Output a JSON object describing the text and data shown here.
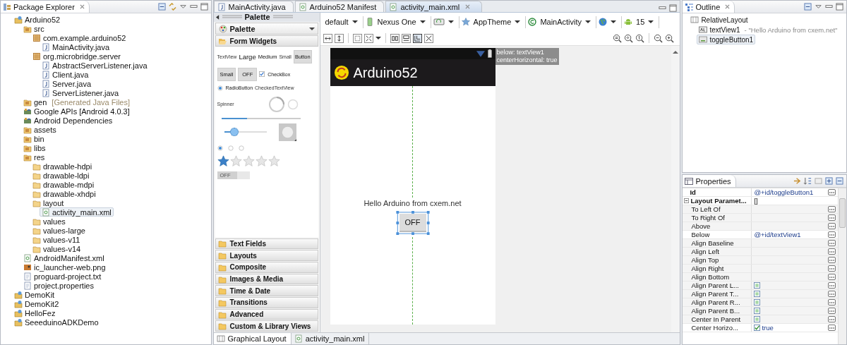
{
  "package_explorer": {
    "title": "Package Explorer",
    "tree": [
      {
        "label": "Arduino52",
        "kind": "project",
        "selected": false,
        "children": [
          {
            "label": "src",
            "kind": "source",
            "selected": false,
            "children": [
              {
                "label": "com.example.arduino52",
                "kind": "package",
                "selected": false,
                "children": [
                  {
                    "label": "MainActivity.java",
                    "kind": "java",
                    "selected": false
                  }
                ]
              },
              {
                "label": "org.microbridge.server",
                "kind": "package",
                "selected": false,
                "children": [
                  {
                    "label": "AbstractServerListener.java",
                    "kind": "java",
                    "selected": false
                  },
                  {
                    "label": "Client.java",
                    "kind": "java",
                    "selected": false
                  },
                  {
                    "label": "Server.java",
                    "kind": "java",
                    "selected": false
                  },
                  {
                    "label": "ServerListener.java",
                    "kind": "java",
                    "selected": false
                  }
                ]
              }
            ]
          },
          {
            "label": "gen",
            "note": "[Generated Java Files]",
            "kind": "source",
            "selected": false
          },
          {
            "label": "Google APIs [Android 4.0.3]",
            "kind": "library",
            "selected": false
          },
          {
            "label": "Android Dependencies",
            "kind": "library",
            "selected": false
          },
          {
            "label": "assets",
            "kind": "source",
            "selected": false
          },
          {
            "label": "bin",
            "kind": "source",
            "selected": false
          },
          {
            "label": "libs",
            "kind": "source",
            "selected": false
          },
          {
            "label": "res",
            "kind": "source",
            "selected": false,
            "children": [
              {
                "label": "drawable-hdpi",
                "kind": "folder",
                "selected": false
              },
              {
                "label": "drawable-ldpi",
                "kind": "folder",
                "selected": false
              },
              {
                "label": "drawable-mdpi",
                "kind": "folder",
                "selected": false
              },
              {
                "label": "drawable-xhdpi",
                "kind": "folder",
                "selected": false
              },
              {
                "label": "layout",
                "kind": "folder",
                "selected": false,
                "children": [
                  {
                    "label": "activity_main.xml",
                    "kind": "xml",
                    "selected": true
                  }
                ]
              },
              {
                "label": "values",
                "kind": "folder",
                "selected": false
              },
              {
                "label": "values-large",
                "kind": "folder",
                "selected": false
              },
              {
                "label": "values-v11",
                "kind": "folder",
                "selected": false
              },
              {
                "label": "values-v14",
                "kind": "folder",
                "selected": false
              }
            ]
          },
          {
            "label": "AndroidManifest.xml",
            "kind": "xml",
            "selected": false
          },
          {
            "label": "ic_launcher-web.png",
            "kind": "image",
            "selected": false
          },
          {
            "label": "proguard-project.txt",
            "kind": "text",
            "selected": false
          },
          {
            "label": "project.properties",
            "kind": "text",
            "selected": false
          }
        ]
      },
      {
        "label": "DemoKit",
        "kind": "project",
        "selected": false
      },
      {
        "label": "DemoKit2",
        "kind": "project",
        "selected": false
      },
      {
        "label": "HelloFez",
        "kind": "project",
        "selected": false
      },
      {
        "label": "SeeeduinoADKDemo",
        "kind": "project",
        "selected": false
      }
    ]
  },
  "editor_tabs": [
    {
      "label": "MainActivity.java",
      "kind": "java",
      "selected": false
    },
    {
      "label": "Arduino52 Manifest",
      "kind": "xml",
      "selected": false
    },
    {
      "label": "activity_main.xml",
      "kind": "xml",
      "selected": true
    }
  ],
  "palette": {
    "title": "Palette",
    "dropdown": "Palette",
    "sections": [
      {
        "label": "Form Widgets",
        "expanded": true
      },
      {
        "label": "Text Fields",
        "expanded": false
      },
      {
        "label": "Layouts",
        "expanded": false
      },
      {
        "label": "Composite",
        "expanded": false
      },
      {
        "label": "Images & Media",
        "expanded": false
      },
      {
        "label": "Time & Date",
        "expanded": false
      },
      {
        "label": "Transitions",
        "expanded": false
      },
      {
        "label": "Advanced",
        "expanded": false
      },
      {
        "label": "Custom & Library Views",
        "expanded": false
      }
    ],
    "widgets": {
      "text_views": [
        {
          "label": "TextView",
          "kind": "tiny"
        },
        {
          "label": "Large",
          "kind": "large"
        },
        {
          "label": "Medium",
          "kind": "medium"
        },
        {
          "label": "Small",
          "kind": "tiny"
        }
      ],
      "button": "Button",
      "small_button": "Small",
      "toggle": "OFF",
      "checkbox": {
        "label": "CheckBox",
        "checked": true
      },
      "radio_button": {
        "label": "RadioButton",
        "selected": true
      },
      "checked_text_view": "CheckedTextView",
      "spinner": "Spinner",
      "progress": {
        "level": 0.33
      },
      "seek_bar": {
        "level": 0.28
      },
      "radio_group": [
        {
          "selected": true
        },
        {
          "selected": false
        },
        {
          "selected": false
        }
      ],
      "rating": {
        "stars": 1
      },
      "switch": "OFF"
    }
  },
  "toolbar": [
    {
      "kind": "text",
      "label": "default"
    },
    {
      "kind": "device",
      "label": "Nexus One"
    },
    {
      "kind": "orientation"
    },
    {
      "kind": "theme",
      "label": "AppTheme"
    },
    {
      "kind": "activity",
      "label": "MainActivity"
    },
    {
      "kind": "locale"
    },
    {
      "kind": "api",
      "label": "15"
    }
  ],
  "canvas": {
    "app_title": "Arduino52",
    "text_view": "Hello Arduino from cxem.net",
    "toggle": "OFF",
    "tooltip": [
      "below: textView1",
      "centerHorizontal: true"
    ]
  },
  "bottom_tabs": [
    {
      "label": "Graphical Layout",
      "kind": "layout",
      "selected": true
    },
    {
      "label": "activity_main.xml",
      "kind": "xml",
      "selected": false
    }
  ],
  "outline": {
    "title": "Outline",
    "tree": [
      {
        "label": "RelativeLayout",
        "kind": "layout",
        "selected": false,
        "children": [
          {
            "label": "textView1",
            "note": "- \"Hello Arduino from cxem.net\"",
            "kind": "textview",
            "selected": false
          },
          {
            "label": "toggleButton1",
            "kind": "toggle",
            "selected": true
          }
        ]
      }
    ]
  },
  "properties": {
    "title": "Properties",
    "rows": [
      {
        "kind": "id",
        "name": "Id",
        "value": "@+id/toggleButton1"
      },
      {
        "kind": "group",
        "name": "Layout Paramet...",
        "value": "[]",
        "expanded": true
      },
      {
        "kind": "text",
        "name": "To Left Of"
      },
      {
        "kind": "text",
        "name": "To Right Of"
      },
      {
        "kind": "text",
        "name": "Above"
      },
      {
        "kind": "text",
        "name": "Below",
        "value": "@+id/textView1"
      },
      {
        "kind": "text",
        "name": "Align Baseline"
      },
      {
        "kind": "text",
        "name": "Align Left"
      },
      {
        "kind": "text",
        "name": "Align Top"
      },
      {
        "kind": "text",
        "name": "Align Right"
      },
      {
        "kind": "text",
        "name": "Align Bottom"
      },
      {
        "kind": "check",
        "name": "Align Parent L...",
        "checked": false
      },
      {
        "kind": "check",
        "name": "Align Parent T...",
        "checked": false
      },
      {
        "kind": "check",
        "name": "Align Parent R...",
        "checked": false
      },
      {
        "kind": "check",
        "name": "Align Parent B...",
        "checked": false
      },
      {
        "kind": "check",
        "name": "Center In Parent",
        "checked": false
      },
      {
        "kind": "check",
        "name": "Center Horizo...",
        "checked": true,
        "value": "true"
      }
    ]
  }
}
